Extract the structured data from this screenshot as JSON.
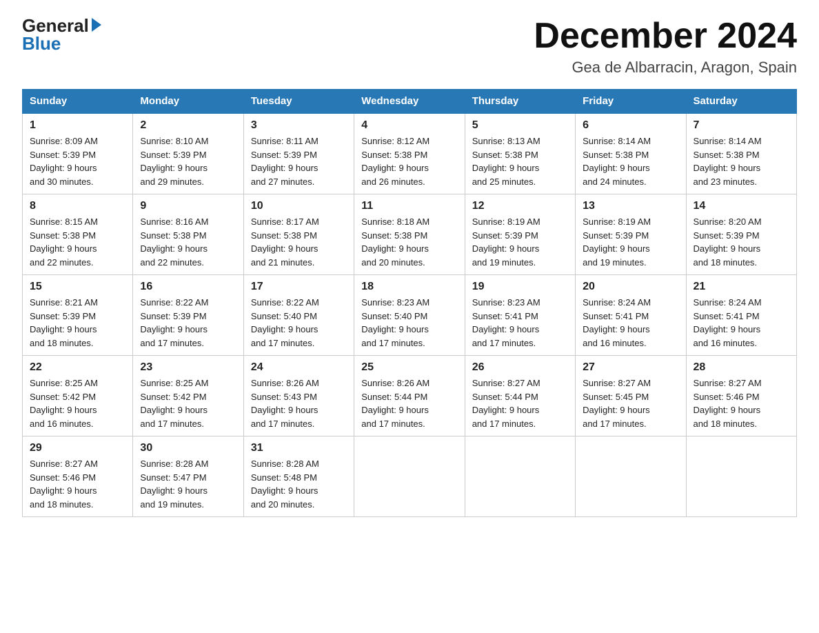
{
  "logo": {
    "general": "General",
    "blue": "Blue"
  },
  "title": "December 2024",
  "location": "Gea de Albarracin, Aragon, Spain",
  "days_of_week": [
    "Sunday",
    "Monday",
    "Tuesday",
    "Wednesday",
    "Thursday",
    "Friday",
    "Saturday"
  ],
  "weeks": [
    [
      {
        "day": "1",
        "info": "Sunrise: 8:09 AM\nSunset: 5:39 PM\nDaylight: 9 hours\nand 30 minutes."
      },
      {
        "day": "2",
        "info": "Sunrise: 8:10 AM\nSunset: 5:39 PM\nDaylight: 9 hours\nand 29 minutes."
      },
      {
        "day": "3",
        "info": "Sunrise: 8:11 AM\nSunset: 5:39 PM\nDaylight: 9 hours\nand 27 minutes."
      },
      {
        "day": "4",
        "info": "Sunrise: 8:12 AM\nSunset: 5:38 PM\nDaylight: 9 hours\nand 26 minutes."
      },
      {
        "day": "5",
        "info": "Sunrise: 8:13 AM\nSunset: 5:38 PM\nDaylight: 9 hours\nand 25 minutes."
      },
      {
        "day": "6",
        "info": "Sunrise: 8:14 AM\nSunset: 5:38 PM\nDaylight: 9 hours\nand 24 minutes."
      },
      {
        "day": "7",
        "info": "Sunrise: 8:14 AM\nSunset: 5:38 PM\nDaylight: 9 hours\nand 23 minutes."
      }
    ],
    [
      {
        "day": "8",
        "info": "Sunrise: 8:15 AM\nSunset: 5:38 PM\nDaylight: 9 hours\nand 22 minutes."
      },
      {
        "day": "9",
        "info": "Sunrise: 8:16 AM\nSunset: 5:38 PM\nDaylight: 9 hours\nand 22 minutes."
      },
      {
        "day": "10",
        "info": "Sunrise: 8:17 AM\nSunset: 5:38 PM\nDaylight: 9 hours\nand 21 minutes."
      },
      {
        "day": "11",
        "info": "Sunrise: 8:18 AM\nSunset: 5:38 PM\nDaylight: 9 hours\nand 20 minutes."
      },
      {
        "day": "12",
        "info": "Sunrise: 8:19 AM\nSunset: 5:39 PM\nDaylight: 9 hours\nand 19 minutes."
      },
      {
        "day": "13",
        "info": "Sunrise: 8:19 AM\nSunset: 5:39 PM\nDaylight: 9 hours\nand 19 minutes."
      },
      {
        "day": "14",
        "info": "Sunrise: 8:20 AM\nSunset: 5:39 PM\nDaylight: 9 hours\nand 18 minutes."
      }
    ],
    [
      {
        "day": "15",
        "info": "Sunrise: 8:21 AM\nSunset: 5:39 PM\nDaylight: 9 hours\nand 18 minutes."
      },
      {
        "day": "16",
        "info": "Sunrise: 8:22 AM\nSunset: 5:39 PM\nDaylight: 9 hours\nand 17 minutes."
      },
      {
        "day": "17",
        "info": "Sunrise: 8:22 AM\nSunset: 5:40 PM\nDaylight: 9 hours\nand 17 minutes."
      },
      {
        "day": "18",
        "info": "Sunrise: 8:23 AM\nSunset: 5:40 PM\nDaylight: 9 hours\nand 17 minutes."
      },
      {
        "day": "19",
        "info": "Sunrise: 8:23 AM\nSunset: 5:41 PM\nDaylight: 9 hours\nand 17 minutes."
      },
      {
        "day": "20",
        "info": "Sunrise: 8:24 AM\nSunset: 5:41 PM\nDaylight: 9 hours\nand 16 minutes."
      },
      {
        "day": "21",
        "info": "Sunrise: 8:24 AM\nSunset: 5:41 PM\nDaylight: 9 hours\nand 16 minutes."
      }
    ],
    [
      {
        "day": "22",
        "info": "Sunrise: 8:25 AM\nSunset: 5:42 PM\nDaylight: 9 hours\nand 16 minutes."
      },
      {
        "day": "23",
        "info": "Sunrise: 8:25 AM\nSunset: 5:42 PM\nDaylight: 9 hours\nand 17 minutes."
      },
      {
        "day": "24",
        "info": "Sunrise: 8:26 AM\nSunset: 5:43 PM\nDaylight: 9 hours\nand 17 minutes."
      },
      {
        "day": "25",
        "info": "Sunrise: 8:26 AM\nSunset: 5:44 PM\nDaylight: 9 hours\nand 17 minutes."
      },
      {
        "day": "26",
        "info": "Sunrise: 8:27 AM\nSunset: 5:44 PM\nDaylight: 9 hours\nand 17 minutes."
      },
      {
        "day": "27",
        "info": "Sunrise: 8:27 AM\nSunset: 5:45 PM\nDaylight: 9 hours\nand 17 minutes."
      },
      {
        "day": "28",
        "info": "Sunrise: 8:27 AM\nSunset: 5:46 PM\nDaylight: 9 hours\nand 18 minutes."
      }
    ],
    [
      {
        "day": "29",
        "info": "Sunrise: 8:27 AM\nSunset: 5:46 PM\nDaylight: 9 hours\nand 18 minutes."
      },
      {
        "day": "30",
        "info": "Sunrise: 8:28 AM\nSunset: 5:47 PM\nDaylight: 9 hours\nand 19 minutes."
      },
      {
        "day": "31",
        "info": "Sunrise: 8:28 AM\nSunset: 5:48 PM\nDaylight: 9 hours\nand 20 minutes."
      },
      {
        "day": "",
        "info": ""
      },
      {
        "day": "",
        "info": ""
      },
      {
        "day": "",
        "info": ""
      },
      {
        "day": "",
        "info": ""
      }
    ]
  ]
}
